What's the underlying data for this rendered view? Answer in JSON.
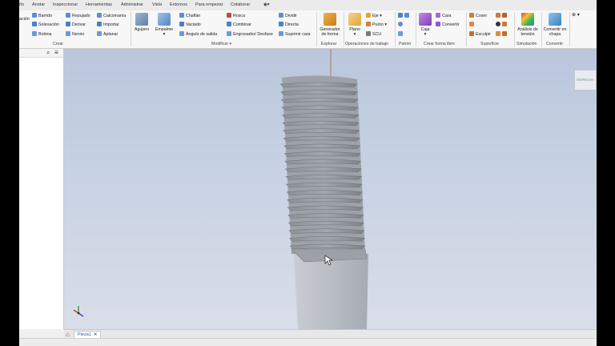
{
  "menu": [
    "ño",
    "Anotar",
    "Inspeccionar",
    "Herramientas",
    "Administrar",
    "Vista",
    "Entornos",
    "Para empezar",
    "Colaborar"
  ],
  "ribbon": {
    "create": {
      "partial_left": "ación",
      "items": [
        "Barrido",
        "Solevación",
        "Bobina",
        "Repujado",
        "Derivar",
        "Nervio",
        "Calcomanía",
        "Importar",
        "Aplanar"
      ],
      "group": "Crear"
    },
    "modify": {
      "big": [
        "Agujero",
        "Empalme"
      ],
      "items": [
        "Chaflán",
        "Vaciado",
        "Ángulo de salida",
        "Rosca",
        "Combinar",
        "Engrosador/ Desfase",
        "Dividir",
        "Directa",
        "Suprimir cara"
      ],
      "group": "Modificar ▾"
    },
    "explore": {
      "big": "Generador de forma",
      "group": "Explorar"
    },
    "workfeatures": {
      "big": "Plano",
      "items": [
        "Eje",
        "Punto",
        "SCU"
      ],
      "group": "Operaciones de trabajo"
    },
    "pattern": {
      "group": "Patrón"
    },
    "freeform": {
      "big": "Caja",
      "items": [
        "Cara",
        "Convertir"
      ],
      "group": "Crear forma libre"
    },
    "surface": {
      "items": [
        "Coser",
        "Esculpir"
      ],
      "group": "Superficie"
    },
    "simulation": {
      "big": "Análisis de tensión",
      "group": "Simulación"
    },
    "convert": {
      "big": "Convertir en chapa",
      "group": "Convertir"
    }
  },
  "viewcube_label": "DERECHA",
  "tabs": {
    "doc": "Pieza1",
    "close": "✕",
    "home": "⌂"
  },
  "colors": {
    "viewport_top": "#b9c6dc",
    "viewport_bottom": "#d9dee8",
    "bolt": "#b8bdc4"
  }
}
